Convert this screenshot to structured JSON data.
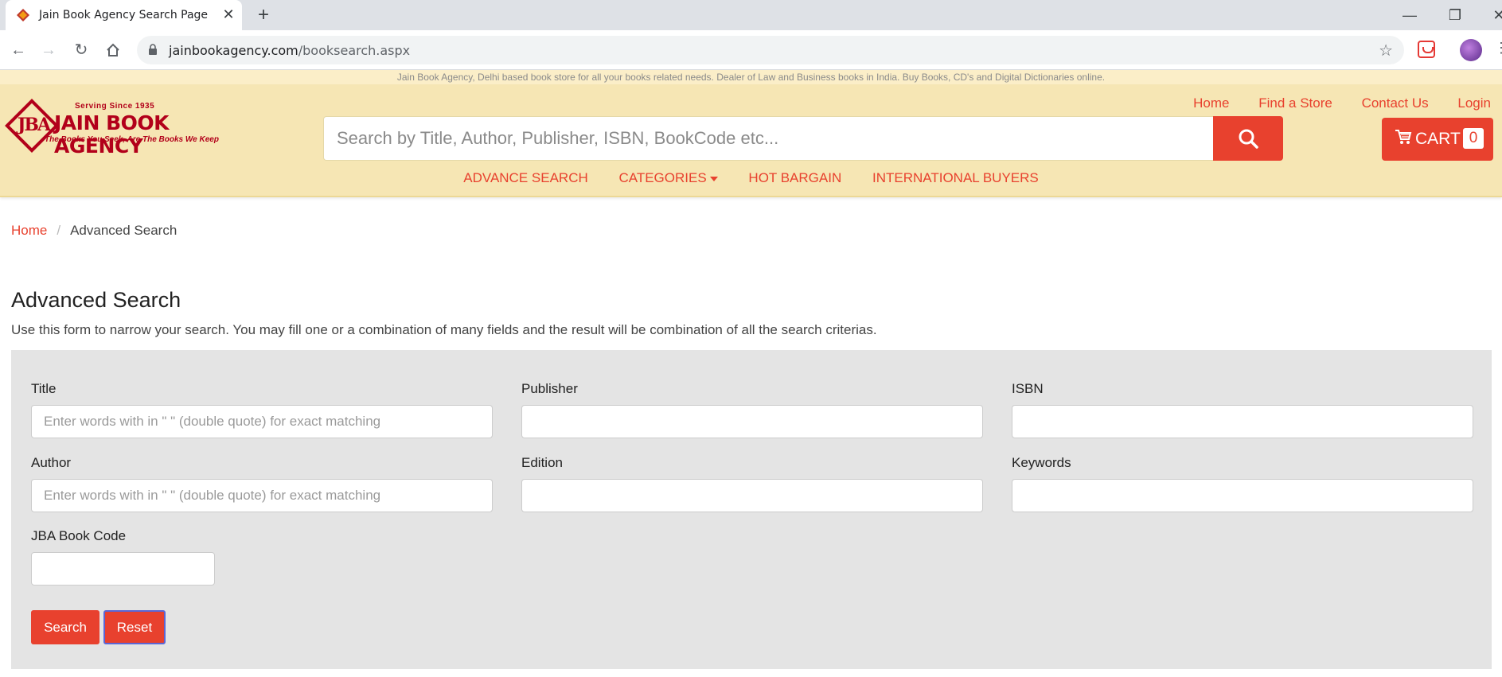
{
  "browser": {
    "tab_title": "Jain Book Agency Search Page",
    "url_domain": "jainbookagency.com",
    "url_path": "/booksearch.aspx"
  },
  "site": {
    "top_strip": "Jain Book Agency, Delhi based book store for all your books related needs. Dealer of Law and Business books in India. Buy Books, CD's and Digital Dictionaries online.",
    "logo": {
      "serving": "Serving Since 1935",
      "name": "JAIN BOOK AGENCY",
      "tagline": "The Books You Seek, Are The Books We Keep",
      "mark": "JBA"
    },
    "search_placeholder": "Search by Title, Author, Publisher, ISBN, BookCode etc...",
    "top_links": [
      "Home",
      "Find a Store",
      "Contact Us",
      "Login"
    ],
    "cart_label": "CART",
    "cart_count": "0",
    "nav": {
      "advance_search": "ADVANCE SEARCH",
      "categories": "CATEGORIES",
      "hot_bargain": "HOT BARGAIN",
      "international_buyers": "INTERNATIONAL BUYERS"
    },
    "colors": {
      "accent": "#e8412e",
      "header_bg": "#f6e6b4",
      "brand": "#b2001a"
    }
  },
  "breadcrumb": {
    "home": "Home",
    "current": "Advanced Search"
  },
  "page": {
    "title": "Advanced Search",
    "description": "Use this form to narrow your search. You may fill one or a combination of many fields and the result will be combination of all the search criterias."
  },
  "form": {
    "title_label": "Title",
    "title_placeholder": "Enter words with in \" \" (double quote) for exact matching",
    "publisher_label": "Publisher",
    "isbn_label": "ISBN",
    "author_label": "Author",
    "author_placeholder": "Enter words with in \" \" (double quote) for exact matching",
    "edition_label": "Edition",
    "keywords_label": "Keywords",
    "bookcode_label": "JBA Book Code",
    "search_button": "Search",
    "reset_button": "Reset"
  }
}
